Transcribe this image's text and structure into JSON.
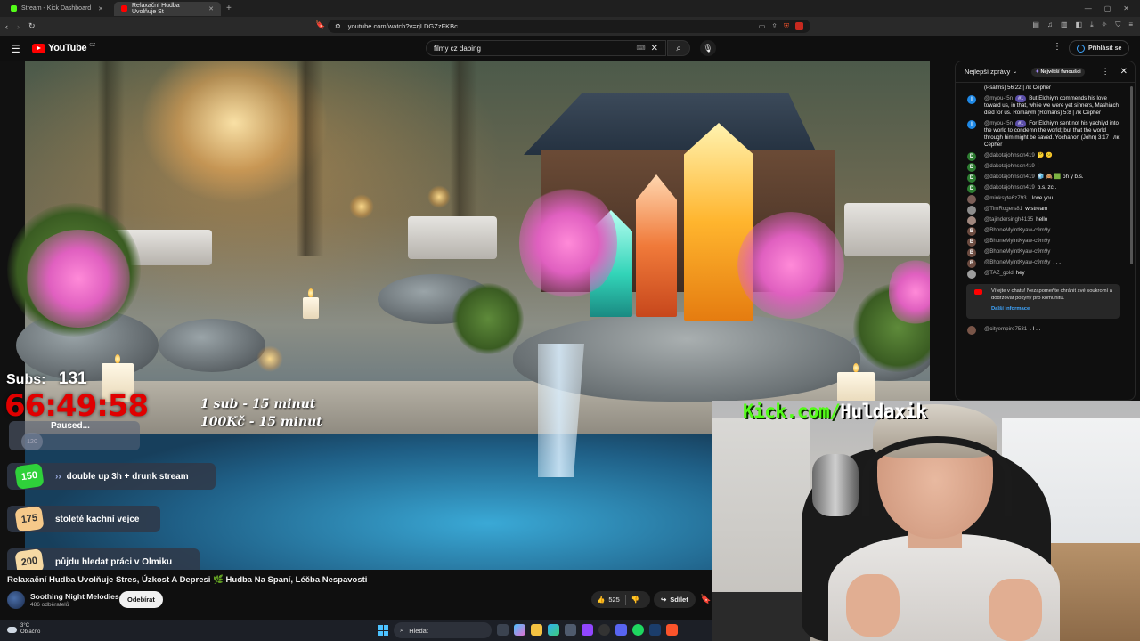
{
  "browser": {
    "tabs": [
      {
        "title": "Stream - Kick Dashboard",
        "favicon_color": "#53fc18"
      },
      {
        "title": "Relaxační Hudba Uvolňuje St",
        "favicon_color": "#ff0000"
      }
    ],
    "new_tab": "+",
    "url": "youtube.com/watch?v=rjLDGZzFKBc",
    "ext_badge": "1"
  },
  "yt": {
    "logo": "YouTube",
    "region": "CZ",
    "search_value": "filmy cz dabing",
    "signin": "Přihlásit se"
  },
  "overlay": {
    "subs_label": "Subs:",
    "subs_count": "131",
    "timer": "66:49:58",
    "rate_line1": "1 sub - 15 minut",
    "rate_line2": "100Kč - 15 minut",
    "paused_badge": "120",
    "paused_text": "Paused...",
    "goals": [
      {
        "badge": "150",
        "text": "double up 3h + drunk stream",
        "badge_color": "#2fd13a"
      },
      {
        "badge": "175",
        "text": "stoleté kachní vejce",
        "badge_color": "#f6c98a"
      },
      {
        "badge": "200",
        "text": "půjdu hledat práci v Olmiku",
        "badge_color": "#f6d9a4"
      }
    ]
  },
  "video": {
    "title": "Relaxační Hudba Uvolňuje Stres, Úzkost A Depresi 🌿 Hudba Na Spaní, Léčba Nespavosti",
    "channel": "Soothing Night Melodies",
    "channel_subs": "486 odběratelů",
    "subscribe": "Odebírat",
    "likes": "525",
    "share": "Sdílet"
  },
  "chat": {
    "header": "Nejlepší zprávy",
    "pill": "Největší fanoušci",
    "messages": [
      {
        "author": "",
        "text": "(Psalms) 56:22 | лк Cepher",
        "avatar": "",
        "color": "#0f0f0f"
      },
      {
        "author": "@myou-t5n",
        "mod": "#1",
        "text": "But Elohiym commends his love toward us, in that, while we were yet sinners, Mashiach died for us. Romaiym (Romans) 5:8 | лк Cepher",
        "avatar": "I",
        "color": "#1e88e5"
      },
      {
        "author": "@myou-t5n",
        "mod": "#1",
        "text": "For Elohiym sent not his yachiyd into the world to condemn the world; but that the world through him might be saved. Yochanon (John) 3:17 | лк Cepher",
        "avatar": "I",
        "color": "#1e88e5"
      },
      {
        "author": "@dakotajohnson419",
        "text": "🤔 😕",
        "avatar": "D",
        "color": "#2e7d32"
      },
      {
        "author": "@dakotajohnson419",
        "text": "!",
        "avatar": "D",
        "color": "#2e7d32"
      },
      {
        "author": "@dakotajohnson419",
        "text": "🧊 🙈 🟩 oh y b.s.",
        "avatar": "D",
        "color": "#2e7d32"
      },
      {
        "author": "@dakotajohnson419",
        "text": "b.s. zc .",
        "avatar": "D",
        "color": "#2e7d32"
      },
      {
        "author": "@minksyte6z793",
        "text": "I love you",
        "avatar": "",
        "color": "#7b5e57"
      },
      {
        "author": "@TimRogers81",
        "text": "w stream",
        "avatar": "",
        "color": "#8d8d8d"
      },
      {
        "author": "@tajindersingh4135",
        "text": "hello",
        "avatar": "",
        "color": "#a1887f"
      },
      {
        "author": "@BhoneMyintKyaw-c9m9y",
        "text": "",
        "avatar": "B",
        "color": "#6d4c41"
      },
      {
        "author": "@BhoneMyintKyaw-c9m9y",
        "text": "",
        "avatar": "B",
        "color": "#6d4c41"
      },
      {
        "author": "@BhoneMyintKyaw-c9m9y",
        "text": "",
        "avatar": "B",
        "color": "#6d4c41"
      },
      {
        "author": "@BhoneMyintKyaw-c9m9y",
        "text": ". . .",
        "avatar": "B",
        "color": "#6d4c41"
      },
      {
        "author": "@TAZ_gold",
        "text": "hey",
        "avatar": "",
        "color": "#9e9e9e"
      }
    ],
    "system_text": "Vítejte v chatu! Nezapomeňte chránit své soukromí a dodržovat pokyny pro komunitu.",
    "system_link": "Další informace",
    "after": [
      {
        "author": "@cityempire7531",
        "text": ". I . .",
        "avatar": "",
        "color": "#795548"
      }
    ]
  },
  "webcam": {
    "kick_prefix": "Kick.com/",
    "kick_name": "Huldaxik"
  },
  "taskbar": {
    "temp": "3°C",
    "weather": "Oblačno",
    "search": "Hledat"
  }
}
